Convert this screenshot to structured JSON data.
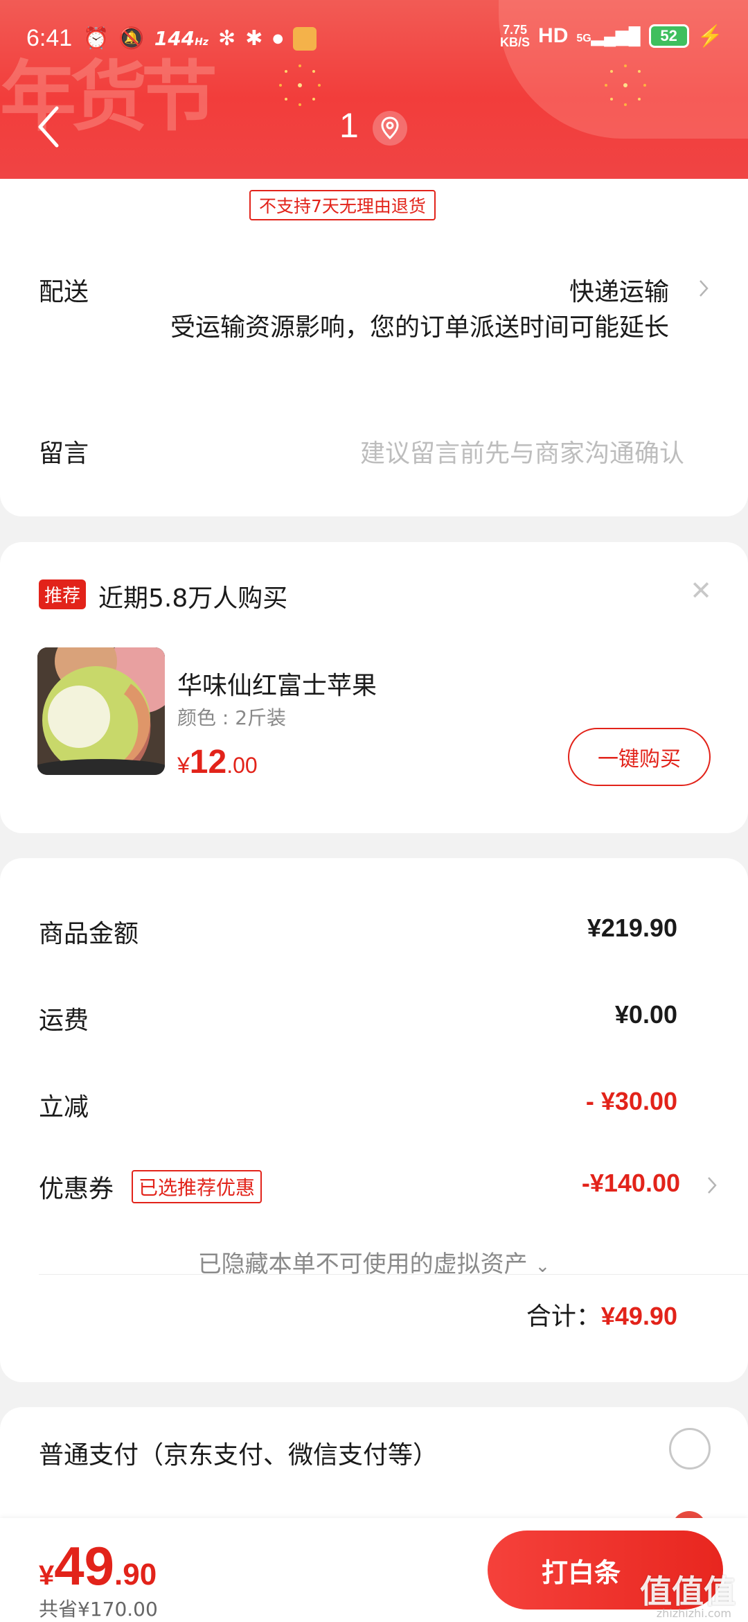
{
  "status": {
    "time": "6:41",
    "refresh_rate": "144",
    "refresh_unit": "Hz",
    "net_speed": "7.75",
    "net_speed_unit": "KB/S",
    "hd": "HD",
    "signal": "5G",
    "battery": "52"
  },
  "header": {
    "title": "1",
    "banner_text": "年货节",
    "accent": "#f23d3b"
  },
  "order": {
    "no_return_tag": "不支持7天无理由退货",
    "delivery_label": "配送",
    "delivery_value": "快递运输",
    "delivery_note": "受运输资源影响，您的订单派送时间可能延长",
    "message_label": "留言",
    "message_placeholder": "建议留言前先与商家沟通确认"
  },
  "recommend": {
    "tag": "推荐",
    "title": "近期5.8万人购买",
    "product_name": "华味仙红富士苹果",
    "spec": "颜色 : 2斤装",
    "price_symbol": "¥",
    "price_int": "12",
    "price_dec": ".00",
    "buy_label": "一键购买"
  },
  "summary": {
    "goods_label": "商品金额",
    "goods_value": "¥219.90",
    "shipping_label": "运费",
    "shipping_value": "¥0.00",
    "discount_label": "立减",
    "discount_value": "- ¥30.00",
    "coupon_label": "优惠券",
    "coupon_tag": "已选推荐优惠",
    "coupon_value": "-¥140.00",
    "hidden_assets": "已隐藏本单不可使用的虚拟资产",
    "total_label": "合计：",
    "total_value": "¥49.90"
  },
  "payment": {
    "normal_label": "普通支付（京东支付、微信支付等）"
  },
  "bottom": {
    "price_symbol": "¥",
    "price_int": "49",
    "price_dec": ".90",
    "saved": "共省¥170.00",
    "pay_button": "打白条",
    "watermark": "值值值",
    "watermark_sub": "zhizhizhi.com"
  },
  "colors": {
    "red": "#e2231a",
    "gray_text": "#888888"
  }
}
